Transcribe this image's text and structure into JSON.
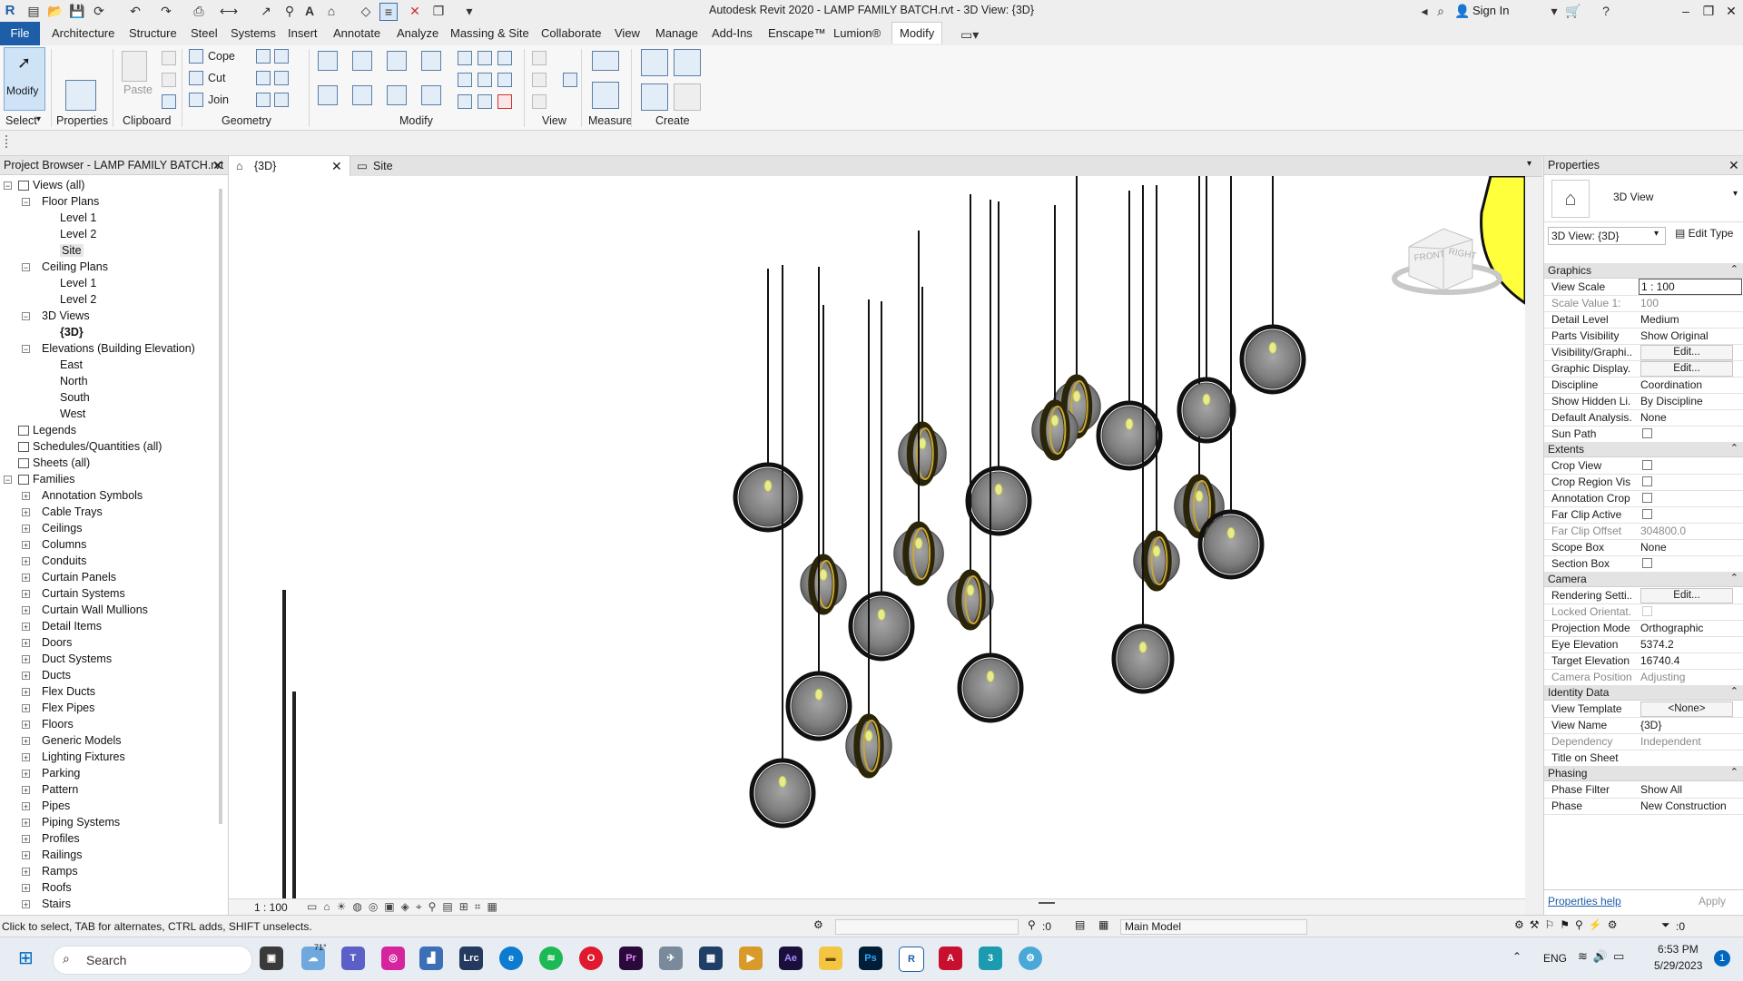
{
  "window": {
    "title": "Autodesk Revit 2020 - LAMP FAMILY BATCH.rvt - 3D View: {3D}",
    "sign_in": "Sign In"
  },
  "menu": {
    "tabs": [
      "File",
      "Architecture",
      "Structure",
      "Steel",
      "Systems",
      "Insert",
      "Annotate",
      "Analyze",
      "Massing & Site",
      "Collaborate",
      "View",
      "Manage",
      "Add-Ins",
      "Enscape™",
      "Lumion®",
      "Modify"
    ]
  },
  "ribbon": {
    "select": "Select",
    "modify": "Modify",
    "properties": "Properties",
    "paste": "Paste",
    "clipboard": "Clipboard",
    "geometry": "Geometry",
    "modify_panel": "Modify",
    "view": "View",
    "measure": "Measure",
    "create": "Create",
    "cope": "Cope",
    "cut": "Cut",
    "join": "Join"
  },
  "project_browser": {
    "title": "Project Browser - LAMP FAMILY BATCH.rvt",
    "views_root": "Views (all)",
    "floor_plans": "Floor Plans",
    "floor_items": [
      "Level 1",
      "Level 2",
      "Site"
    ],
    "ceiling_plans": "Ceiling Plans",
    "ceiling_items": [
      "Level 1",
      "Level 2"
    ],
    "views_3d": "3D Views",
    "views_3d_items": [
      "{3D}"
    ],
    "elevations": "Elevations (Building Elevation)",
    "elevation_items": [
      "East",
      "North",
      "South",
      "West"
    ],
    "legends": "Legends",
    "schedules": "Schedules/Quantities (all)",
    "sheets": "Sheets (all)",
    "families": "Families",
    "family_items": [
      "Annotation Symbols",
      "Cable Trays",
      "Ceilings",
      "Columns",
      "Conduits",
      "Curtain Panels",
      "Curtain Systems",
      "Curtain Wall Mullions",
      "Detail Items",
      "Doors",
      "Duct Systems",
      "Ducts",
      "Flex Ducts",
      "Flex Pipes",
      "Floors",
      "Generic Models",
      "Lighting Fixtures",
      "Parking",
      "Pattern",
      "Pipes",
      "Piping Systems",
      "Profiles",
      "Railings",
      "Ramps",
      "Roofs",
      "Stairs"
    ]
  },
  "view_tabs": [
    "{3D}",
    "Site"
  ],
  "viewcube": {
    "front": "FRONT",
    "right": "RIGHT"
  },
  "view_scale_label": "1 : 100",
  "properties": {
    "title": "Properties",
    "type_name": "3D View",
    "selector": "3D View: {3D}",
    "edit_type": "Edit Type",
    "sections": {
      "graphics": "Graphics",
      "extents": "Extents",
      "camera": "Camera",
      "identity": "Identity Data",
      "phasing": "Phasing"
    },
    "graphics": [
      {
        "name": "View Scale",
        "value": "1 : 100"
      },
      {
        "name": "Scale Value    1:",
        "value": "100"
      },
      {
        "name": "Detail Level",
        "value": "Medium"
      },
      {
        "name": "Parts Visibility",
        "value": "Show Original"
      },
      {
        "name": "Visibility/Graphi...",
        "value": "Edit..."
      },
      {
        "name": "Graphic Display...",
        "value": "Edit..."
      },
      {
        "name": "Discipline",
        "value": "Coordination"
      },
      {
        "name": "Show Hidden Li...",
        "value": "By Discipline"
      },
      {
        "name": "Default Analysis...",
        "value": "None"
      },
      {
        "name": "Sun Path",
        "value": ""
      }
    ],
    "extents": [
      {
        "name": "Crop View",
        "value": ""
      },
      {
        "name": "Crop Region Vis...",
        "value": ""
      },
      {
        "name": "Annotation Crop",
        "value": ""
      },
      {
        "name": "Far Clip Active",
        "value": ""
      },
      {
        "name": "Far Clip Offset",
        "value": "304800.0"
      },
      {
        "name": "Scope Box",
        "value": "None"
      },
      {
        "name": "Section Box",
        "value": ""
      }
    ],
    "camera": [
      {
        "name": "Rendering Setti...",
        "value": "Edit..."
      },
      {
        "name": "Locked Orientat...",
        "value": ""
      },
      {
        "name": "Projection Mode",
        "value": "Orthographic"
      },
      {
        "name": "Eye Elevation",
        "value": "5374.2"
      },
      {
        "name": "Target Elevation",
        "value": "16740.4"
      },
      {
        "name": "Camera Position",
        "value": "Adjusting"
      }
    ],
    "identity": [
      {
        "name": "View Template",
        "value": "<None>"
      },
      {
        "name": "View Name",
        "value": "{3D}"
      },
      {
        "name": "Dependency",
        "value": "Independent"
      },
      {
        "name": "Title on Sheet",
        "value": ""
      }
    ],
    "phasing": [
      {
        "name": "Phase Filter",
        "value": "Show All"
      },
      {
        "name": "Phase",
        "value": "New Construction"
      }
    ],
    "help": "Properties help",
    "apply": "Apply"
  },
  "status": {
    "message": "Click to select, TAB for alternates, CTRL adds, SHIFT unselects.",
    "coord": ":0",
    "model": "Main Model",
    "filter_count": ":0"
  },
  "taskbar": {
    "search": "Search",
    "weather": "71°",
    "lang": "ENG",
    "time": "6:53 PM",
    "date": "5/29/2023",
    "badge": "1"
  }
}
